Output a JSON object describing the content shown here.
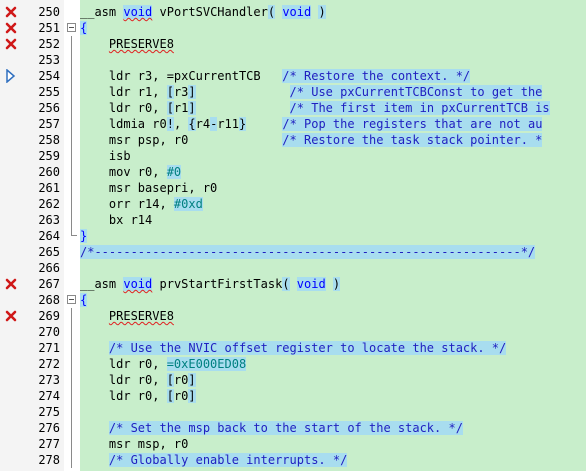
{
  "editor": {
    "colors": {
      "background": "#c8eecb",
      "comment": "#2020c0",
      "keyword": "#0000ff",
      "highlight": "#a8ddef",
      "error_marker": "#d01818"
    },
    "lines": [
      {
        "n": "250",
        "marker": "error",
        "fold": "none",
        "tokens": [
          [
            "plain",
            "__asm "
          ],
          [
            "kwu",
            "void"
          ],
          [
            "plain",
            " vPortSVCHandler"
          ],
          [
            "op",
            "("
          ],
          [
            "plain",
            " "
          ],
          [
            "kw",
            "void"
          ],
          [
            "plain",
            " "
          ],
          [
            "op",
            ")"
          ]
        ]
      },
      {
        "n": "251",
        "marker": "error",
        "fold": "start",
        "tokens": [
          [
            "brace",
            "{"
          ]
        ]
      },
      {
        "n": "252",
        "marker": "error",
        "fold": "line",
        "tokens": [
          [
            "plain",
            "    "
          ],
          [
            "uline",
            "PRESERVE8"
          ]
        ]
      },
      {
        "n": "253",
        "marker": "none",
        "fold": "line",
        "tokens": []
      },
      {
        "n": "254",
        "marker": "arrow",
        "fold": "line",
        "tokens": [
          [
            "plain",
            "    ldr r3, =pxCurrentTCB   "
          ],
          [
            "cmt",
            "/* Restore the context. */"
          ]
        ]
      },
      {
        "n": "255",
        "marker": "none",
        "fold": "line",
        "tokens": [
          [
            "plain",
            "    ldr r1, "
          ],
          [
            "op",
            "["
          ],
          [
            "plain",
            "r3"
          ],
          [
            "op",
            "]"
          ],
          [
            "plain",
            "             "
          ],
          [
            "cmt",
            "/* Use pxCurrentTCBConst to get the"
          ]
        ]
      },
      {
        "n": "256",
        "marker": "none",
        "fold": "line",
        "tokens": [
          [
            "plain",
            "    ldr r0, "
          ],
          [
            "op",
            "["
          ],
          [
            "plain",
            "r1"
          ],
          [
            "op",
            "]"
          ],
          [
            "plain",
            "             "
          ],
          [
            "cmt",
            "/* The first item in pxCurrentTCB is"
          ]
        ]
      },
      {
        "n": "257",
        "marker": "none",
        "fold": "line",
        "tokens": [
          [
            "plain",
            "    ldmia r0"
          ],
          [
            "op",
            "!"
          ],
          [
            "plain",
            ", "
          ],
          [
            "op",
            "{"
          ],
          [
            "plain",
            "r4"
          ],
          [
            "op",
            "-"
          ],
          [
            "plain",
            "r11"
          ],
          [
            "op",
            "}"
          ],
          [
            "plain",
            "     "
          ],
          [
            "cmt",
            "/* Pop the registers that are not au"
          ]
        ]
      },
      {
        "n": "258",
        "marker": "none",
        "fold": "line",
        "tokens": [
          [
            "plain",
            "    msr psp, r0             "
          ],
          [
            "cmt",
            "/* Restore the task stack pointer. *"
          ]
        ]
      },
      {
        "n": "259",
        "marker": "none",
        "fold": "line",
        "tokens": [
          [
            "plain",
            "    isb"
          ]
        ]
      },
      {
        "n": "260",
        "marker": "none",
        "fold": "line",
        "tokens": [
          [
            "plain",
            "    mov r0, "
          ],
          [
            "num",
            "#0"
          ]
        ]
      },
      {
        "n": "261",
        "marker": "none",
        "fold": "line",
        "tokens": [
          [
            "plain",
            "    msr basepri, r0"
          ]
        ]
      },
      {
        "n": "262",
        "marker": "none",
        "fold": "line",
        "tokens": [
          [
            "plain",
            "    orr r14, "
          ],
          [
            "num",
            "#0xd"
          ]
        ]
      },
      {
        "n": "263",
        "marker": "none",
        "fold": "line",
        "tokens": [
          [
            "plain",
            "    bx r14"
          ]
        ]
      },
      {
        "n": "264",
        "marker": "none",
        "fold": "end",
        "tokens": [
          [
            "brace",
            "}"
          ]
        ]
      },
      {
        "n": "265",
        "marker": "none",
        "fold": "none",
        "tokens": [
          [
            "cmt",
            "/*-----------------------------------------------------------*/"
          ]
        ]
      },
      {
        "n": "266",
        "marker": "none",
        "fold": "none",
        "tokens": []
      },
      {
        "n": "267",
        "marker": "error",
        "fold": "none",
        "tokens": [
          [
            "plain",
            "__asm "
          ],
          [
            "kwu",
            "void"
          ],
          [
            "plain",
            " prvStartFirstTask"
          ],
          [
            "op",
            "("
          ],
          [
            "plain",
            " "
          ],
          [
            "kw",
            "void"
          ],
          [
            "plain",
            " "
          ],
          [
            "op",
            ")"
          ]
        ]
      },
      {
        "n": "268",
        "marker": "none",
        "fold": "start",
        "tokens": [
          [
            "brace",
            "{"
          ]
        ]
      },
      {
        "n": "269",
        "marker": "error",
        "fold": "line",
        "tokens": [
          [
            "plain",
            "    "
          ],
          [
            "uline",
            "PRESERVE8"
          ]
        ]
      },
      {
        "n": "270",
        "marker": "none",
        "fold": "line",
        "tokens": []
      },
      {
        "n": "271",
        "marker": "none",
        "fold": "line",
        "tokens": [
          [
            "plain",
            "    "
          ],
          [
            "cmt",
            "/* Use the NVIC offset register to locate the stack. */"
          ]
        ]
      },
      {
        "n": "272",
        "marker": "none",
        "fold": "line",
        "tokens": [
          [
            "plain",
            "    ldr r0, "
          ],
          [
            "num",
            "=0xE000ED08"
          ]
        ]
      },
      {
        "n": "273",
        "marker": "none",
        "fold": "line",
        "tokens": [
          [
            "plain",
            "    ldr r0, "
          ],
          [
            "op",
            "["
          ],
          [
            "plain",
            "r0"
          ],
          [
            "op",
            "]"
          ]
        ]
      },
      {
        "n": "274",
        "marker": "none",
        "fold": "line",
        "tokens": [
          [
            "plain",
            "    ldr r0, "
          ],
          [
            "op",
            "["
          ],
          [
            "plain",
            "r0"
          ],
          [
            "op",
            "]"
          ]
        ]
      },
      {
        "n": "275",
        "marker": "none",
        "fold": "line",
        "tokens": []
      },
      {
        "n": "276",
        "marker": "none",
        "fold": "line",
        "tokens": [
          [
            "plain",
            "    "
          ],
          [
            "cmt",
            "/* Set the msp back to the start of the stack. */"
          ]
        ]
      },
      {
        "n": "277",
        "marker": "none",
        "fold": "line",
        "tokens": [
          [
            "plain",
            "    msr msp, r0"
          ]
        ]
      },
      {
        "n": "278",
        "marker": "none",
        "fold": "line",
        "tokens": [
          [
            "plain",
            "    "
          ],
          [
            "cmt",
            "/* Globally enable interrupts. */"
          ]
        ]
      }
    ]
  }
}
